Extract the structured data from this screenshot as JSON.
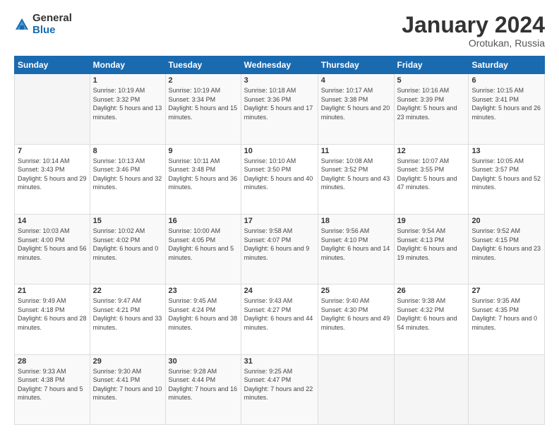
{
  "logo": {
    "general": "General",
    "blue": "Blue"
  },
  "title": "January 2024",
  "location": "Orotukan, Russia",
  "days_header": [
    "Sunday",
    "Monday",
    "Tuesday",
    "Wednesday",
    "Thursday",
    "Friday",
    "Saturday"
  ],
  "weeks": [
    [
      {
        "day": "",
        "sunrise": "",
        "sunset": "",
        "daylight": ""
      },
      {
        "day": "1",
        "sunrise": "Sunrise: 10:19 AM",
        "sunset": "Sunset: 3:32 PM",
        "daylight": "Daylight: 5 hours and 13 minutes."
      },
      {
        "day": "2",
        "sunrise": "Sunrise: 10:19 AM",
        "sunset": "Sunset: 3:34 PM",
        "daylight": "Daylight: 5 hours and 15 minutes."
      },
      {
        "day": "3",
        "sunrise": "Sunrise: 10:18 AM",
        "sunset": "Sunset: 3:36 PM",
        "daylight": "Daylight: 5 hours and 17 minutes."
      },
      {
        "day": "4",
        "sunrise": "Sunrise: 10:17 AM",
        "sunset": "Sunset: 3:38 PM",
        "daylight": "Daylight: 5 hours and 20 minutes."
      },
      {
        "day": "5",
        "sunrise": "Sunrise: 10:16 AM",
        "sunset": "Sunset: 3:39 PM",
        "daylight": "Daylight: 5 hours and 23 minutes."
      },
      {
        "day": "6",
        "sunrise": "Sunrise: 10:15 AM",
        "sunset": "Sunset: 3:41 PM",
        "daylight": "Daylight: 5 hours and 26 minutes."
      }
    ],
    [
      {
        "day": "7",
        "sunrise": "Sunrise: 10:14 AM",
        "sunset": "Sunset: 3:43 PM",
        "daylight": "Daylight: 5 hours and 29 minutes."
      },
      {
        "day": "8",
        "sunrise": "Sunrise: 10:13 AM",
        "sunset": "Sunset: 3:46 PM",
        "daylight": "Daylight: 5 hours and 32 minutes."
      },
      {
        "day": "9",
        "sunrise": "Sunrise: 10:11 AM",
        "sunset": "Sunset: 3:48 PM",
        "daylight": "Daylight: 5 hours and 36 minutes."
      },
      {
        "day": "10",
        "sunrise": "Sunrise: 10:10 AM",
        "sunset": "Sunset: 3:50 PM",
        "daylight": "Daylight: 5 hours and 40 minutes."
      },
      {
        "day": "11",
        "sunrise": "Sunrise: 10:08 AM",
        "sunset": "Sunset: 3:52 PM",
        "daylight": "Daylight: 5 hours and 43 minutes."
      },
      {
        "day": "12",
        "sunrise": "Sunrise: 10:07 AM",
        "sunset": "Sunset: 3:55 PM",
        "daylight": "Daylight: 5 hours and 47 minutes."
      },
      {
        "day": "13",
        "sunrise": "Sunrise: 10:05 AM",
        "sunset": "Sunset: 3:57 PM",
        "daylight": "Daylight: 5 hours and 52 minutes."
      }
    ],
    [
      {
        "day": "14",
        "sunrise": "Sunrise: 10:03 AM",
        "sunset": "Sunset: 4:00 PM",
        "daylight": "Daylight: 5 hours and 56 minutes."
      },
      {
        "day": "15",
        "sunrise": "Sunrise: 10:02 AM",
        "sunset": "Sunset: 4:02 PM",
        "daylight": "Daylight: 6 hours and 0 minutes."
      },
      {
        "day": "16",
        "sunrise": "Sunrise: 10:00 AM",
        "sunset": "Sunset: 4:05 PM",
        "daylight": "Daylight: 6 hours and 5 minutes."
      },
      {
        "day": "17",
        "sunrise": "Sunrise: 9:58 AM",
        "sunset": "Sunset: 4:07 PM",
        "daylight": "Daylight: 6 hours and 9 minutes."
      },
      {
        "day": "18",
        "sunrise": "Sunrise: 9:56 AM",
        "sunset": "Sunset: 4:10 PM",
        "daylight": "Daylight: 6 hours and 14 minutes."
      },
      {
        "day": "19",
        "sunrise": "Sunrise: 9:54 AM",
        "sunset": "Sunset: 4:13 PM",
        "daylight": "Daylight: 6 hours and 19 minutes."
      },
      {
        "day": "20",
        "sunrise": "Sunrise: 9:52 AM",
        "sunset": "Sunset: 4:15 PM",
        "daylight": "Daylight: 6 hours and 23 minutes."
      }
    ],
    [
      {
        "day": "21",
        "sunrise": "Sunrise: 9:49 AM",
        "sunset": "Sunset: 4:18 PM",
        "daylight": "Daylight: 6 hours and 28 minutes."
      },
      {
        "day": "22",
        "sunrise": "Sunrise: 9:47 AM",
        "sunset": "Sunset: 4:21 PM",
        "daylight": "Daylight: 6 hours and 33 minutes."
      },
      {
        "day": "23",
        "sunrise": "Sunrise: 9:45 AM",
        "sunset": "Sunset: 4:24 PM",
        "daylight": "Daylight: 6 hours and 38 minutes."
      },
      {
        "day": "24",
        "sunrise": "Sunrise: 9:43 AM",
        "sunset": "Sunset: 4:27 PM",
        "daylight": "Daylight: 6 hours and 44 minutes."
      },
      {
        "day": "25",
        "sunrise": "Sunrise: 9:40 AM",
        "sunset": "Sunset: 4:30 PM",
        "daylight": "Daylight: 6 hours and 49 minutes."
      },
      {
        "day": "26",
        "sunrise": "Sunrise: 9:38 AM",
        "sunset": "Sunset: 4:32 PM",
        "daylight": "Daylight: 6 hours and 54 minutes."
      },
      {
        "day": "27",
        "sunrise": "Sunrise: 9:35 AM",
        "sunset": "Sunset: 4:35 PM",
        "daylight": "Daylight: 7 hours and 0 minutes."
      }
    ],
    [
      {
        "day": "28",
        "sunrise": "Sunrise: 9:33 AM",
        "sunset": "Sunset: 4:38 PM",
        "daylight": "Daylight: 7 hours and 5 minutes."
      },
      {
        "day": "29",
        "sunrise": "Sunrise: 9:30 AM",
        "sunset": "Sunset: 4:41 PM",
        "daylight": "Daylight: 7 hours and 10 minutes."
      },
      {
        "day": "30",
        "sunrise": "Sunrise: 9:28 AM",
        "sunset": "Sunset: 4:44 PM",
        "daylight": "Daylight: 7 hours and 16 minutes."
      },
      {
        "day": "31",
        "sunrise": "Sunrise: 9:25 AM",
        "sunset": "Sunset: 4:47 PM",
        "daylight": "Daylight: 7 hours and 22 minutes."
      },
      {
        "day": "",
        "sunrise": "",
        "sunset": "",
        "daylight": ""
      },
      {
        "day": "",
        "sunrise": "",
        "sunset": "",
        "daylight": ""
      },
      {
        "day": "",
        "sunrise": "",
        "sunset": "",
        "daylight": ""
      }
    ]
  ]
}
